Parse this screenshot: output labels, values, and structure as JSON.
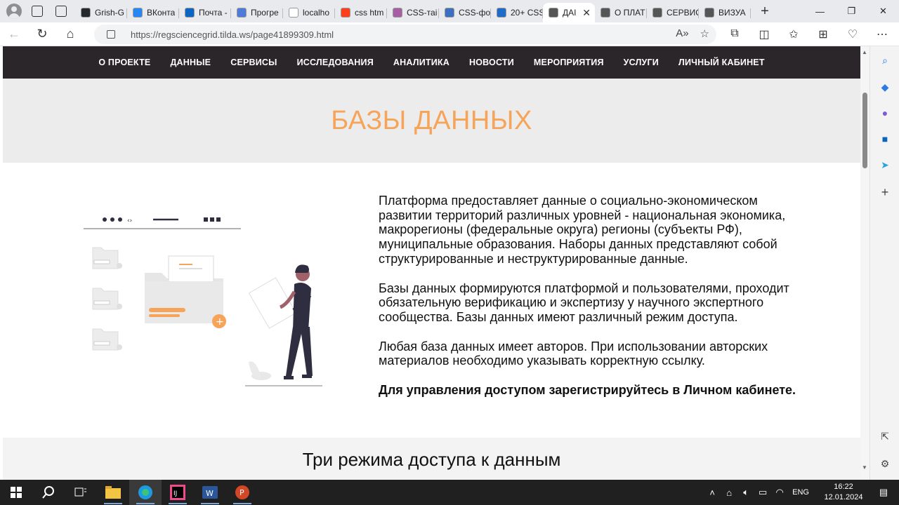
{
  "browser": {
    "tabs": [
      {
        "label": "Grish-G",
        "fav_color": "#24292f"
      },
      {
        "label": "ВКонта",
        "fav_color": "#2787f5"
      },
      {
        "label": "Почта -",
        "fav_color": "#0a66c2"
      },
      {
        "label": "Прогре",
        "fav_color": "#4f7bd9"
      },
      {
        "label": "localho",
        "fav_color": "#ffffff"
      },
      {
        "label": "css htm",
        "fav_color": "#fc3f1d"
      },
      {
        "label": "CSS-таі",
        "fav_color": "#a55fa3"
      },
      {
        "label": "CSS-фо",
        "fav_color": "#3c6fc0"
      },
      {
        "label": "20+ CSS",
        "fav_color": "#1e6cc8"
      },
      {
        "label": "ДАІ",
        "fav_color": "#555555",
        "active": true
      },
      {
        "label": "О ПЛАТ",
        "fav_color": "#555555"
      },
      {
        "label": "СЕРВИС",
        "fav_color": "#555555"
      },
      {
        "label": "ВИЗУА",
        "fav_color": "#555555"
      }
    ],
    "url": "https://regsciencegrid.tilda.ws/page41899309.html"
  },
  "site": {
    "nav": [
      "О ПРОЕКТЕ",
      "ДАННЫЕ",
      "СЕРВИСЫ",
      "ИССЛЕДОВАНИЯ",
      "АНАЛИТИКА",
      "НОВОСТИ",
      "МЕРОПРИЯТИЯ",
      "УСЛУГИ",
      "ЛИЧНЫЙ КАБИНЕТ"
    ],
    "hero_title": "БАЗЫ ДАННЫХ",
    "paragraphs": [
      "Платформа предоставляет данные о социально-экономическом развитии территорий различных уровней - национальная экономика, макрорегионы (федеральные округа) регионы (субъекты РФ), муниципальные образования. Наборы данных представляют собой структурированные и неструктурированные данные.",
      "Базы данных формируются платформой и пользователями, проходит обязательную верификацию и экспертизу у научного экспертного сообщества. Базы данных имеют различный режим доступа.",
      "Любая база данных имеет авторов. При использовании авторских материалов необходимо указывать корректную ссылку."
    ],
    "bold_note": "Для управления доступом зарегистрируйтесь в Личном кабинете.",
    "section2_title": "Три режима доступа к данным",
    "accent_color": "#f5a45a"
  },
  "taskbar": {
    "lang": "ENG",
    "time": "16:22",
    "date": "12.01.2024"
  }
}
